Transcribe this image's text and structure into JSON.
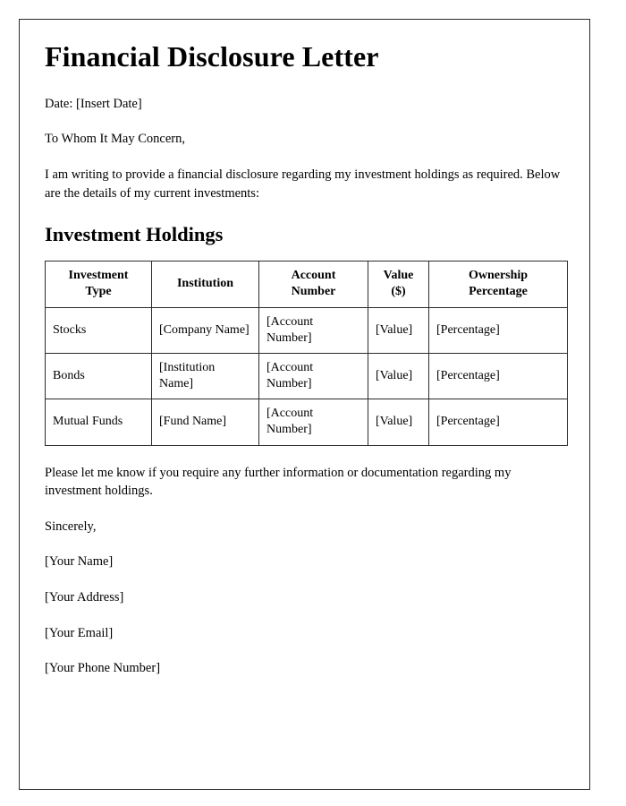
{
  "document": {
    "title": "Financial Disclosure Letter",
    "date_line": "Date: [Insert Date]",
    "salutation": "To Whom It May Concern,",
    "intro_paragraph": "I am writing to provide a financial disclosure regarding my investment holdings as required. Below are the details of my current investments:",
    "section_heading": "Investment Holdings",
    "closing_paragraph": "Please let me know if you require any further information or documentation regarding my investment holdings.",
    "signoff": "Sincerely,",
    "signature_block": [
      "[Your Name]",
      "[Your Address]",
      "[Your Email]",
      "[Your Phone Number]"
    ]
  },
  "table": {
    "headers": [
      "Investment Type",
      "Institution",
      "Account Number",
      "Value ($)",
      "Ownership Percentage"
    ],
    "header_lines": [
      [
        "Investment",
        "Type"
      ],
      [
        "Institution"
      ],
      [
        "Account",
        "Number"
      ],
      [
        "Value",
        "($)"
      ],
      [
        "Ownership",
        "Percentage"
      ]
    ],
    "rows": [
      {
        "investment_type": "Stocks",
        "institution": "[Company Name]",
        "account_number": "[Account Number]",
        "value": "[Value]",
        "ownership_percentage": "[Percentage]"
      },
      {
        "investment_type": "Bonds",
        "institution": "[Institution Name]",
        "account_number": "[Account Number]",
        "value": "[Value]",
        "ownership_percentage": "[Percentage]"
      },
      {
        "investment_type": "Mutual Funds",
        "institution": "[Fund Name]",
        "account_number": "[Account Number]",
        "value": "[Value]",
        "ownership_percentage": "[Percentage]"
      }
    ]
  },
  "colors": {
    "page_background": "#ffffff",
    "text": "#000000",
    "border": "#2b2b2b"
  }
}
